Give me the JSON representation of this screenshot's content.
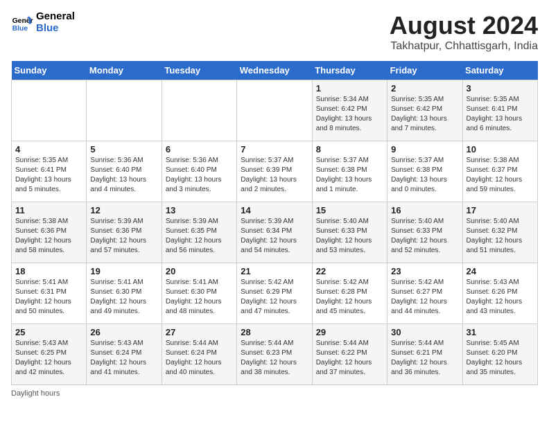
{
  "logo": {
    "line1": "General",
    "line2": "Blue"
  },
  "title": "August 2024",
  "subtitle": "Takhatpur, Chhattisgarh, India",
  "weekdays": [
    "Sunday",
    "Monday",
    "Tuesday",
    "Wednesday",
    "Thursday",
    "Friday",
    "Saturday"
  ],
  "weeks": [
    [
      {
        "day": "",
        "info": ""
      },
      {
        "day": "",
        "info": ""
      },
      {
        "day": "",
        "info": ""
      },
      {
        "day": "",
        "info": ""
      },
      {
        "day": "1",
        "info": "Sunrise: 5:34 AM\nSunset: 6:42 PM\nDaylight: 13 hours and 8 minutes."
      },
      {
        "day": "2",
        "info": "Sunrise: 5:35 AM\nSunset: 6:42 PM\nDaylight: 13 hours and 7 minutes."
      },
      {
        "day": "3",
        "info": "Sunrise: 5:35 AM\nSunset: 6:41 PM\nDaylight: 13 hours and 6 minutes."
      }
    ],
    [
      {
        "day": "4",
        "info": "Sunrise: 5:35 AM\nSunset: 6:41 PM\nDaylight: 13 hours and 5 minutes."
      },
      {
        "day": "5",
        "info": "Sunrise: 5:36 AM\nSunset: 6:40 PM\nDaylight: 13 hours and 4 minutes."
      },
      {
        "day": "6",
        "info": "Sunrise: 5:36 AM\nSunset: 6:40 PM\nDaylight: 13 hours and 3 minutes."
      },
      {
        "day": "7",
        "info": "Sunrise: 5:37 AM\nSunset: 6:39 PM\nDaylight: 13 hours and 2 minutes."
      },
      {
        "day": "8",
        "info": "Sunrise: 5:37 AM\nSunset: 6:38 PM\nDaylight: 13 hours and 1 minute."
      },
      {
        "day": "9",
        "info": "Sunrise: 5:37 AM\nSunset: 6:38 PM\nDaylight: 13 hours and 0 minutes."
      },
      {
        "day": "10",
        "info": "Sunrise: 5:38 AM\nSunset: 6:37 PM\nDaylight: 12 hours and 59 minutes."
      }
    ],
    [
      {
        "day": "11",
        "info": "Sunrise: 5:38 AM\nSunset: 6:36 PM\nDaylight: 12 hours and 58 minutes."
      },
      {
        "day": "12",
        "info": "Sunrise: 5:39 AM\nSunset: 6:36 PM\nDaylight: 12 hours and 57 minutes."
      },
      {
        "day": "13",
        "info": "Sunrise: 5:39 AM\nSunset: 6:35 PM\nDaylight: 12 hours and 56 minutes."
      },
      {
        "day": "14",
        "info": "Sunrise: 5:39 AM\nSunset: 6:34 PM\nDaylight: 12 hours and 54 minutes."
      },
      {
        "day": "15",
        "info": "Sunrise: 5:40 AM\nSunset: 6:33 PM\nDaylight: 12 hours and 53 minutes."
      },
      {
        "day": "16",
        "info": "Sunrise: 5:40 AM\nSunset: 6:33 PM\nDaylight: 12 hours and 52 minutes."
      },
      {
        "day": "17",
        "info": "Sunrise: 5:40 AM\nSunset: 6:32 PM\nDaylight: 12 hours and 51 minutes."
      }
    ],
    [
      {
        "day": "18",
        "info": "Sunrise: 5:41 AM\nSunset: 6:31 PM\nDaylight: 12 hours and 50 minutes."
      },
      {
        "day": "19",
        "info": "Sunrise: 5:41 AM\nSunset: 6:30 PM\nDaylight: 12 hours and 49 minutes."
      },
      {
        "day": "20",
        "info": "Sunrise: 5:41 AM\nSunset: 6:30 PM\nDaylight: 12 hours and 48 minutes."
      },
      {
        "day": "21",
        "info": "Sunrise: 5:42 AM\nSunset: 6:29 PM\nDaylight: 12 hours and 47 minutes."
      },
      {
        "day": "22",
        "info": "Sunrise: 5:42 AM\nSunset: 6:28 PM\nDaylight: 12 hours and 45 minutes."
      },
      {
        "day": "23",
        "info": "Sunrise: 5:42 AM\nSunset: 6:27 PM\nDaylight: 12 hours and 44 minutes."
      },
      {
        "day": "24",
        "info": "Sunrise: 5:43 AM\nSunset: 6:26 PM\nDaylight: 12 hours and 43 minutes."
      }
    ],
    [
      {
        "day": "25",
        "info": "Sunrise: 5:43 AM\nSunset: 6:25 PM\nDaylight: 12 hours and 42 minutes."
      },
      {
        "day": "26",
        "info": "Sunrise: 5:43 AM\nSunset: 6:24 PM\nDaylight: 12 hours and 41 minutes."
      },
      {
        "day": "27",
        "info": "Sunrise: 5:44 AM\nSunset: 6:24 PM\nDaylight: 12 hours and 40 minutes."
      },
      {
        "day": "28",
        "info": "Sunrise: 5:44 AM\nSunset: 6:23 PM\nDaylight: 12 hours and 38 minutes."
      },
      {
        "day": "29",
        "info": "Sunrise: 5:44 AM\nSunset: 6:22 PM\nDaylight: 12 hours and 37 minutes."
      },
      {
        "day": "30",
        "info": "Sunrise: 5:44 AM\nSunset: 6:21 PM\nDaylight: 12 hours and 36 minutes."
      },
      {
        "day": "31",
        "info": "Sunrise: 5:45 AM\nSunset: 6:20 PM\nDaylight: 12 hours and 35 minutes."
      }
    ]
  ],
  "footer": "Daylight hours"
}
